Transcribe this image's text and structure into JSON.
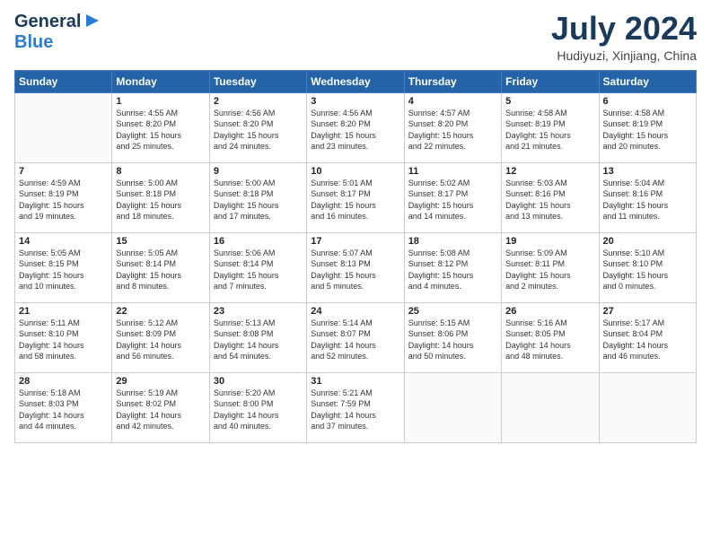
{
  "header": {
    "logo_general": "General",
    "logo_blue": "Blue",
    "title": "July 2024",
    "location": "Hudiyuzi, Xinjiang, China"
  },
  "days_of_week": [
    "Sunday",
    "Monday",
    "Tuesday",
    "Wednesday",
    "Thursday",
    "Friday",
    "Saturday"
  ],
  "weeks": [
    [
      {
        "day": "",
        "info": ""
      },
      {
        "day": "1",
        "info": "Sunrise: 4:55 AM\nSunset: 8:20 PM\nDaylight: 15 hours\nand 25 minutes."
      },
      {
        "day": "2",
        "info": "Sunrise: 4:56 AM\nSunset: 8:20 PM\nDaylight: 15 hours\nand 24 minutes."
      },
      {
        "day": "3",
        "info": "Sunrise: 4:56 AM\nSunset: 8:20 PM\nDaylight: 15 hours\nand 23 minutes."
      },
      {
        "day": "4",
        "info": "Sunrise: 4:57 AM\nSunset: 8:20 PM\nDaylight: 15 hours\nand 22 minutes."
      },
      {
        "day": "5",
        "info": "Sunrise: 4:58 AM\nSunset: 8:19 PM\nDaylight: 15 hours\nand 21 minutes."
      },
      {
        "day": "6",
        "info": "Sunrise: 4:58 AM\nSunset: 8:19 PM\nDaylight: 15 hours\nand 20 minutes."
      }
    ],
    [
      {
        "day": "7",
        "info": "Sunrise: 4:59 AM\nSunset: 8:19 PM\nDaylight: 15 hours\nand 19 minutes."
      },
      {
        "day": "8",
        "info": "Sunrise: 5:00 AM\nSunset: 8:18 PM\nDaylight: 15 hours\nand 18 minutes."
      },
      {
        "day": "9",
        "info": "Sunrise: 5:00 AM\nSunset: 8:18 PM\nDaylight: 15 hours\nand 17 minutes."
      },
      {
        "day": "10",
        "info": "Sunrise: 5:01 AM\nSunset: 8:17 PM\nDaylight: 15 hours\nand 16 minutes."
      },
      {
        "day": "11",
        "info": "Sunrise: 5:02 AM\nSunset: 8:17 PM\nDaylight: 15 hours\nand 14 minutes."
      },
      {
        "day": "12",
        "info": "Sunrise: 5:03 AM\nSunset: 8:16 PM\nDaylight: 15 hours\nand 13 minutes."
      },
      {
        "day": "13",
        "info": "Sunrise: 5:04 AM\nSunset: 8:16 PM\nDaylight: 15 hours\nand 11 minutes."
      }
    ],
    [
      {
        "day": "14",
        "info": "Sunrise: 5:05 AM\nSunset: 8:15 PM\nDaylight: 15 hours\nand 10 minutes."
      },
      {
        "day": "15",
        "info": "Sunrise: 5:05 AM\nSunset: 8:14 PM\nDaylight: 15 hours\nand 8 minutes."
      },
      {
        "day": "16",
        "info": "Sunrise: 5:06 AM\nSunset: 8:14 PM\nDaylight: 15 hours\nand 7 minutes."
      },
      {
        "day": "17",
        "info": "Sunrise: 5:07 AM\nSunset: 8:13 PM\nDaylight: 15 hours\nand 5 minutes."
      },
      {
        "day": "18",
        "info": "Sunrise: 5:08 AM\nSunset: 8:12 PM\nDaylight: 15 hours\nand 4 minutes."
      },
      {
        "day": "19",
        "info": "Sunrise: 5:09 AM\nSunset: 8:11 PM\nDaylight: 15 hours\nand 2 minutes."
      },
      {
        "day": "20",
        "info": "Sunrise: 5:10 AM\nSunset: 8:10 PM\nDaylight: 15 hours\nand 0 minutes."
      }
    ],
    [
      {
        "day": "21",
        "info": "Sunrise: 5:11 AM\nSunset: 8:10 PM\nDaylight: 14 hours\nand 58 minutes."
      },
      {
        "day": "22",
        "info": "Sunrise: 5:12 AM\nSunset: 8:09 PM\nDaylight: 14 hours\nand 56 minutes."
      },
      {
        "day": "23",
        "info": "Sunrise: 5:13 AM\nSunset: 8:08 PM\nDaylight: 14 hours\nand 54 minutes."
      },
      {
        "day": "24",
        "info": "Sunrise: 5:14 AM\nSunset: 8:07 PM\nDaylight: 14 hours\nand 52 minutes."
      },
      {
        "day": "25",
        "info": "Sunrise: 5:15 AM\nSunset: 8:06 PM\nDaylight: 14 hours\nand 50 minutes."
      },
      {
        "day": "26",
        "info": "Sunrise: 5:16 AM\nSunset: 8:05 PM\nDaylight: 14 hours\nand 48 minutes."
      },
      {
        "day": "27",
        "info": "Sunrise: 5:17 AM\nSunset: 8:04 PM\nDaylight: 14 hours\nand 46 minutes."
      }
    ],
    [
      {
        "day": "28",
        "info": "Sunrise: 5:18 AM\nSunset: 8:03 PM\nDaylight: 14 hours\nand 44 minutes."
      },
      {
        "day": "29",
        "info": "Sunrise: 5:19 AM\nSunset: 8:02 PM\nDaylight: 14 hours\nand 42 minutes."
      },
      {
        "day": "30",
        "info": "Sunrise: 5:20 AM\nSunset: 8:00 PM\nDaylight: 14 hours\nand 40 minutes."
      },
      {
        "day": "31",
        "info": "Sunrise: 5:21 AM\nSunset: 7:59 PM\nDaylight: 14 hours\nand 37 minutes."
      },
      {
        "day": "",
        "info": ""
      },
      {
        "day": "",
        "info": ""
      },
      {
        "day": "",
        "info": ""
      }
    ]
  ]
}
